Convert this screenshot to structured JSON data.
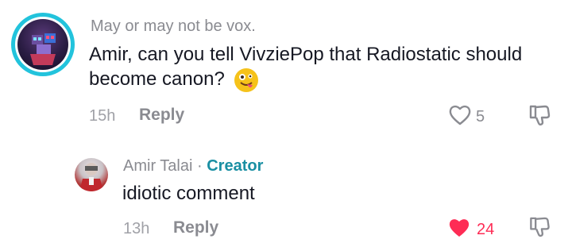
{
  "comments": [
    {
      "username": "May or may not be vox.",
      "text": "Amir, can you tell VivziePop that Radiostatic should become canon?",
      "emoji": "🤪",
      "time": "15h",
      "reply_label": "Reply",
      "like_count": "5",
      "liked": false
    },
    {
      "username": "Amir Talai",
      "separator": "·",
      "badge": "Creator",
      "text": "idiotic comment",
      "time": "13h",
      "reply_label": "Reply",
      "like_count": "24",
      "liked": true
    }
  ],
  "colors": {
    "accent_ring": "#22c3dc",
    "creator_badge": "#1a8fa3",
    "like_active": "#fe2c55",
    "muted_text": "#8a8b91"
  }
}
